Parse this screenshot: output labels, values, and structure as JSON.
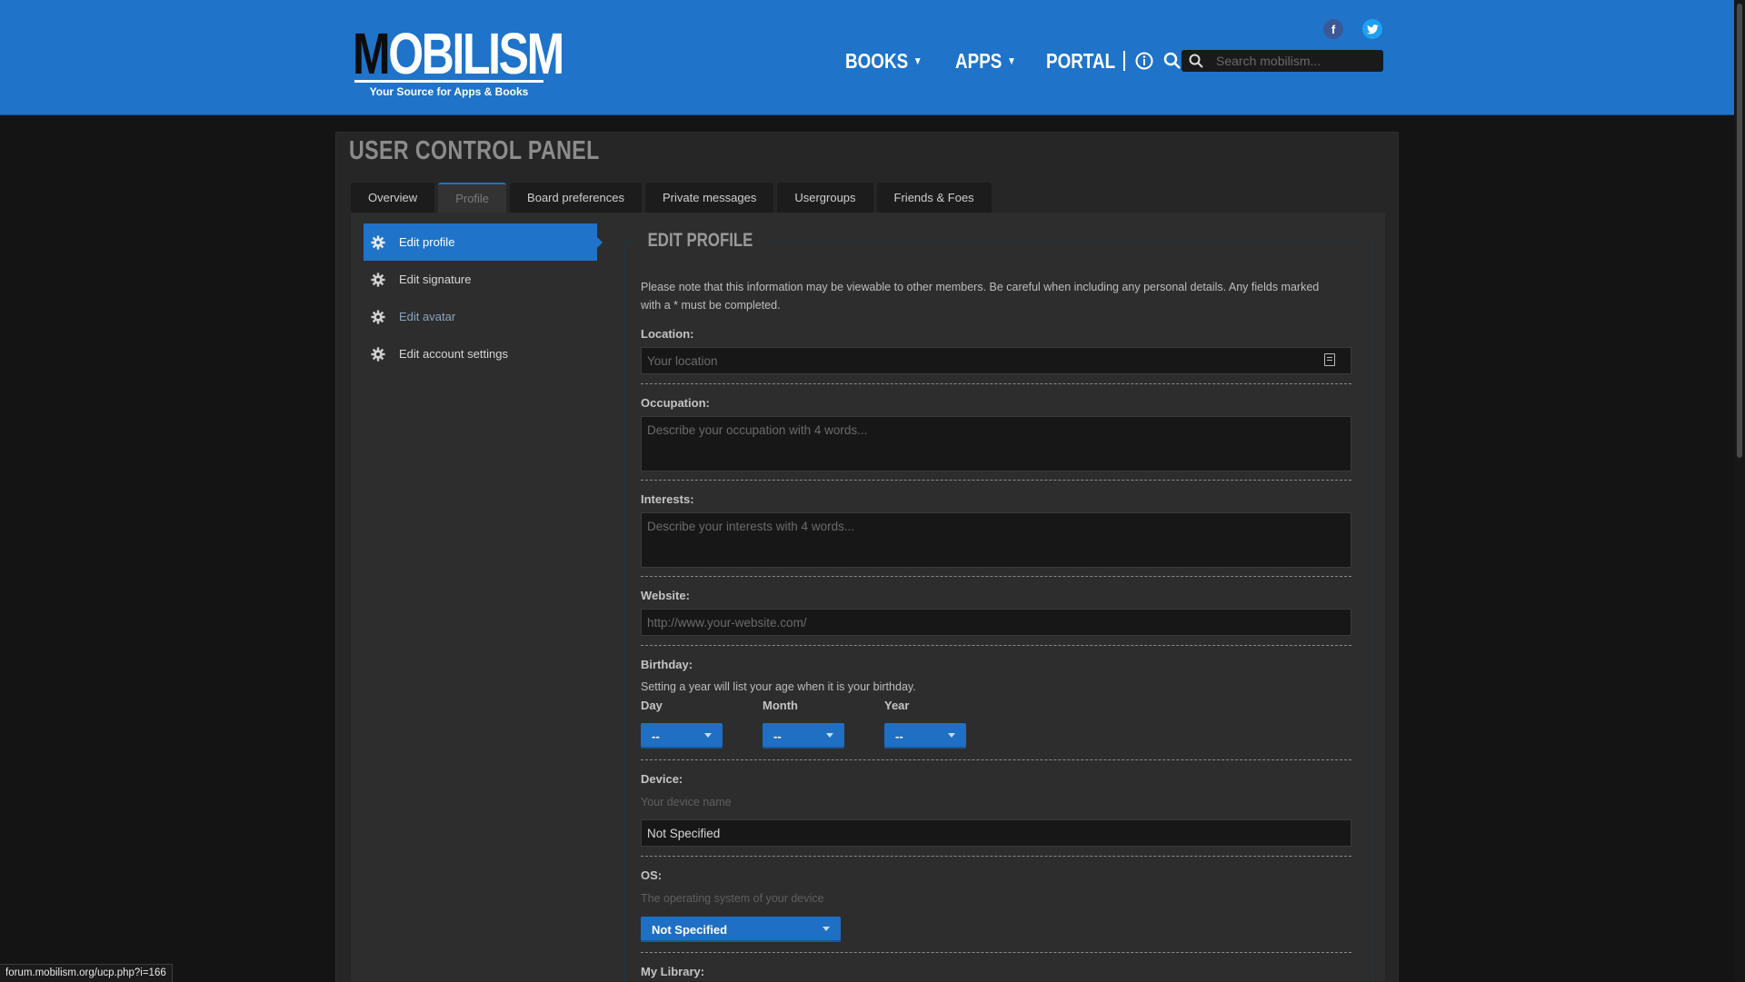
{
  "brand": {
    "name_first": "M",
    "name_rest": "OBILISM",
    "tagline": "Your Source for Apps & Books"
  },
  "nav": {
    "books": "BOOKS",
    "apps": "APPS",
    "portal": "PORTAL",
    "icons": [
      "info-icon",
      "search-icon",
      "mail-icon",
      "gear-icon"
    ]
  },
  "search": {
    "placeholder": "Search mobilism..."
  },
  "social": {
    "facebook": "f",
    "twitter": "t"
  },
  "ucp": {
    "title": "USER CONTROL PANEL",
    "tabs": [
      "Overview",
      "Profile",
      "Board preferences",
      "Private messages",
      "Usergroups",
      "Friends & Foes"
    ],
    "active_tab": "Profile"
  },
  "sidebar": {
    "items": [
      {
        "label": "Edit profile"
      },
      {
        "label": "Edit signature"
      },
      {
        "label": "Edit avatar"
      },
      {
        "label": "Edit account settings"
      }
    ]
  },
  "form": {
    "legend": "EDIT PROFILE",
    "note": "Please note that this information may be viewable to other members. Be careful when including any personal details. Any fields marked with a * must be completed.",
    "location": {
      "label": "Location:",
      "placeholder": "Your location"
    },
    "occupation": {
      "label": "Occupation:",
      "placeholder": "Describe your occupation with 4 words..."
    },
    "interests": {
      "label": "Interests:",
      "placeholder": "Describe your interests with 4 words..."
    },
    "website": {
      "label": "Website:",
      "placeholder": "http://www.your-website.com/"
    },
    "birthday": {
      "label": "Birthday:",
      "note": "Setting a year will list your age when it is your birthday.",
      "day_label": "Day",
      "month_label": "Month",
      "year_label": "Year",
      "day_value": "--",
      "month_value": "--",
      "year_value": "--"
    },
    "device": {
      "label": "Device:",
      "hint": "Your device name",
      "value": "Not Specified"
    },
    "os": {
      "label": "OS:",
      "hint": "The operating system of your device",
      "value": "Not Specified"
    },
    "library": {
      "label": "My Library:"
    }
  },
  "status_bar": {
    "url": "forum.mobilism.org/ucp.php?i=166"
  },
  "colors": {
    "accent": "#1f73c9",
    "panel": "#2d2d2d",
    "background": "#141414"
  }
}
